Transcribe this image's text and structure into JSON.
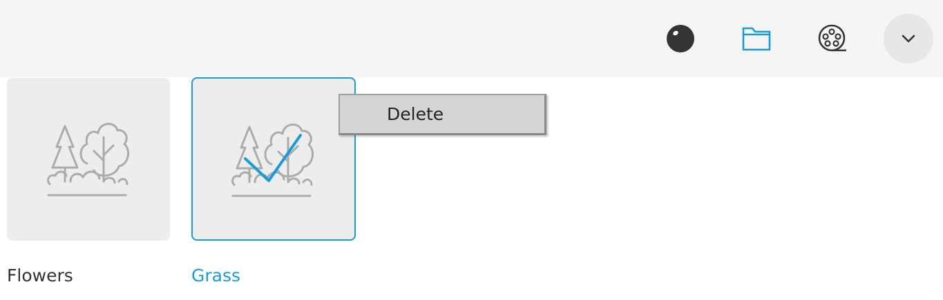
{
  "toolbar": {
    "icons": [
      "ball-icon",
      "folder-icon",
      "film-reel-icon",
      "chevron-down-icon"
    ]
  },
  "colors": {
    "accent": "#1a9ad8",
    "tile_bg": "#ededed",
    "toolbar_bg": "#f5f5f5"
  },
  "items": [
    {
      "label": "Flowers",
      "selected": false,
      "icon": "forest-icon"
    },
    {
      "label": "Grass",
      "selected": true,
      "icon": "forest-icon"
    }
  ],
  "context_menu": {
    "items": [
      {
        "label": "Delete"
      }
    ]
  }
}
